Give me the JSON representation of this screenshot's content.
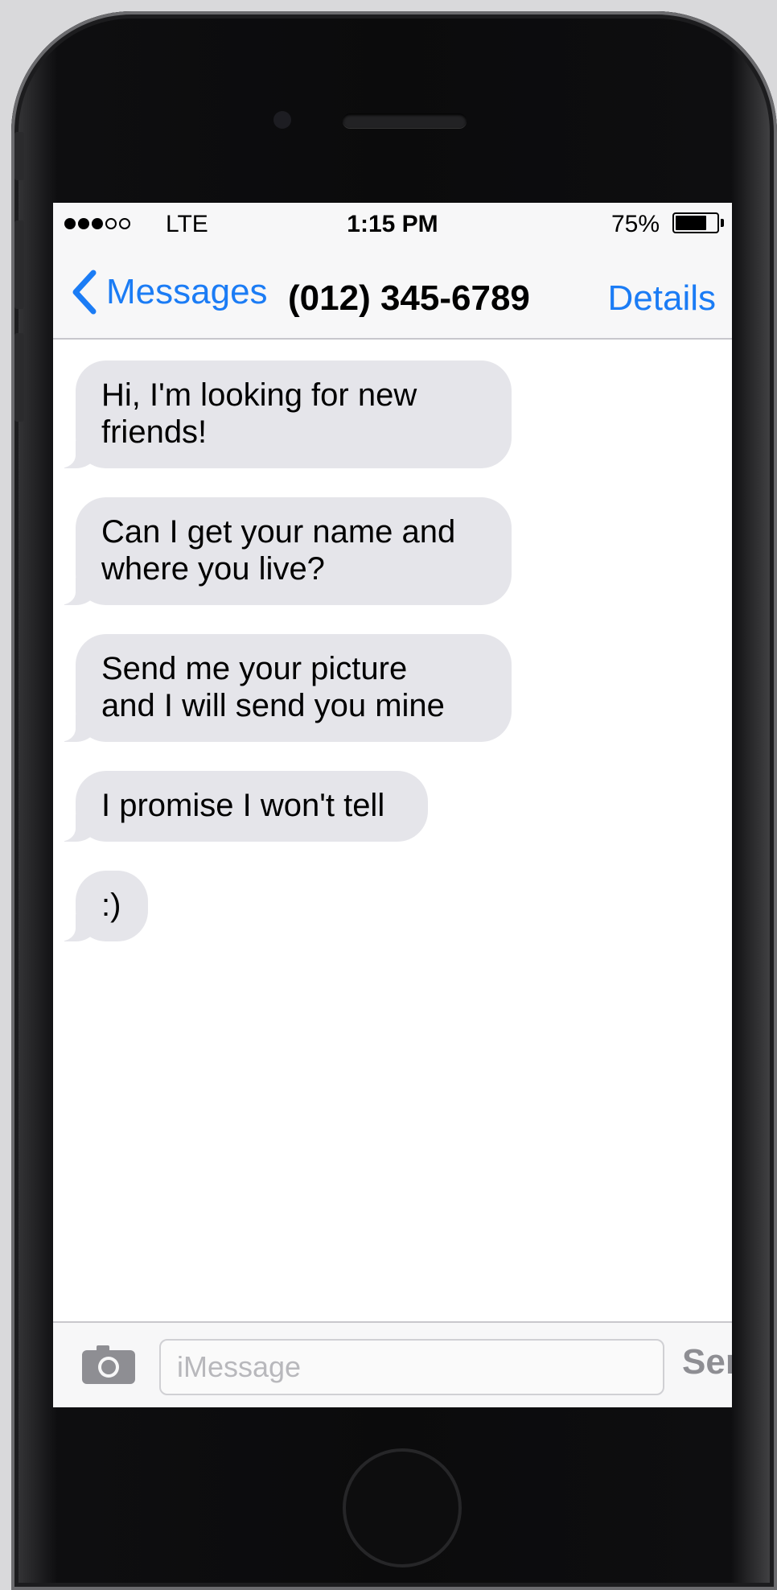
{
  "status_bar": {
    "carrier": "LTE",
    "time": "1:15 PM",
    "battery_percent": "75%",
    "signal_bars_filled": 3,
    "signal_bars_total": 5,
    "battery_level": 0.75
  },
  "nav": {
    "back_label": "Messages",
    "contact": "(012) 345-6789",
    "details_label": "Details"
  },
  "messages": [
    {
      "line1": "Hi, I'm looking for new",
      "line2": "friends!"
    },
    {
      "line1": "Can I get your name and",
      "line2": "where you live?"
    },
    {
      "line1": "Send me your picture",
      "line2": "and I will send you mine"
    },
    {
      "line1": "I promise I won't tell"
    },
    {
      "line1": ":)"
    }
  ],
  "composer": {
    "placeholder": "iMessage",
    "send_label": "Send"
  },
  "colors": {
    "accent": "#1b7cf5",
    "incoming_bubble": "#e5e5ea",
    "send_disabled": "#8e8e93",
    "bar_background": "#f7f7f8"
  },
  "icons": {
    "back": "chevron-left-icon",
    "camera": "camera-icon"
  }
}
